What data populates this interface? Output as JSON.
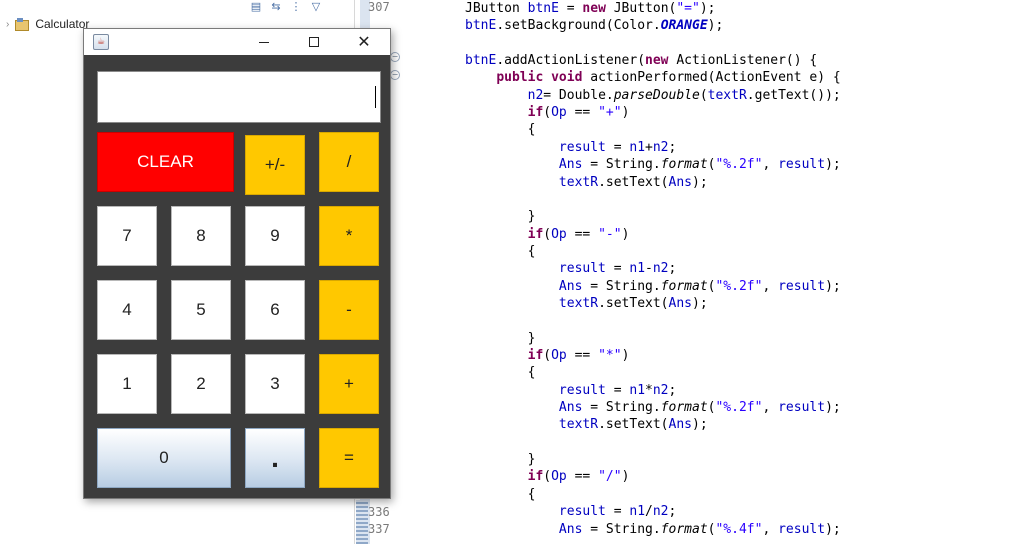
{
  "explorer": {
    "project_name": "Calculator",
    "toolbar_icons": [
      "collapse-all-icon",
      "link-editor-icon",
      "view-menu-icon",
      "dropdown-icon"
    ]
  },
  "gutter": {
    "line_top": "307",
    "line_336": "336",
    "line_337": "337"
  },
  "code": {
    "lines": [
      "JButton btnE = new JButton(\"=\");",
      "btnE.setBackground(Color.ORANGE);",
      "",
      "btnE.addActionListener(new ActionListener() {",
      "    public void actionPerformed(ActionEvent e) {",
      "        n2= Double.parseDouble(textR.getText());",
      "        if(Op == \"+\")",
      "        {",
      "            result = n1+n2;",
      "            Ans = String.format(\"%.2f\", result);",
      "            textR.setText(Ans);",
      "",
      "        }",
      "        if(Op == \"-\")",
      "        {",
      "            result = n1-n2;",
      "            Ans = String.format(\"%.2f\", result);",
      "            textR.setText(Ans);",
      "",
      "        }",
      "        if(Op == \"*\")",
      "        {",
      "            result = n1*n2;",
      "            Ans = String.format(\"%.2f\", result);",
      "            textR.setText(Ans);",
      "",
      "        }",
      "        if(Op == \"/\")",
      "        {",
      "            result = n1/n2;",
      "            Ans = String.format(\"%.4f\", result);"
    ]
  },
  "calculator": {
    "display_value": "",
    "keys": {
      "clear": "CLEAR",
      "negate": "+/-",
      "divide": "/",
      "seven": "7",
      "eight": "8",
      "nine": "9",
      "multiply": "*",
      "four": "4",
      "five": "5",
      "six": "6",
      "subtract": "-",
      "one": "1",
      "two": "2",
      "three": "3",
      "add": "+",
      "zero": "0",
      "decimal": ".",
      "equals": "="
    },
    "colors": {
      "orange": "#ffc800",
      "red": "#ff0000",
      "body": "#3c3c3c"
    }
  }
}
